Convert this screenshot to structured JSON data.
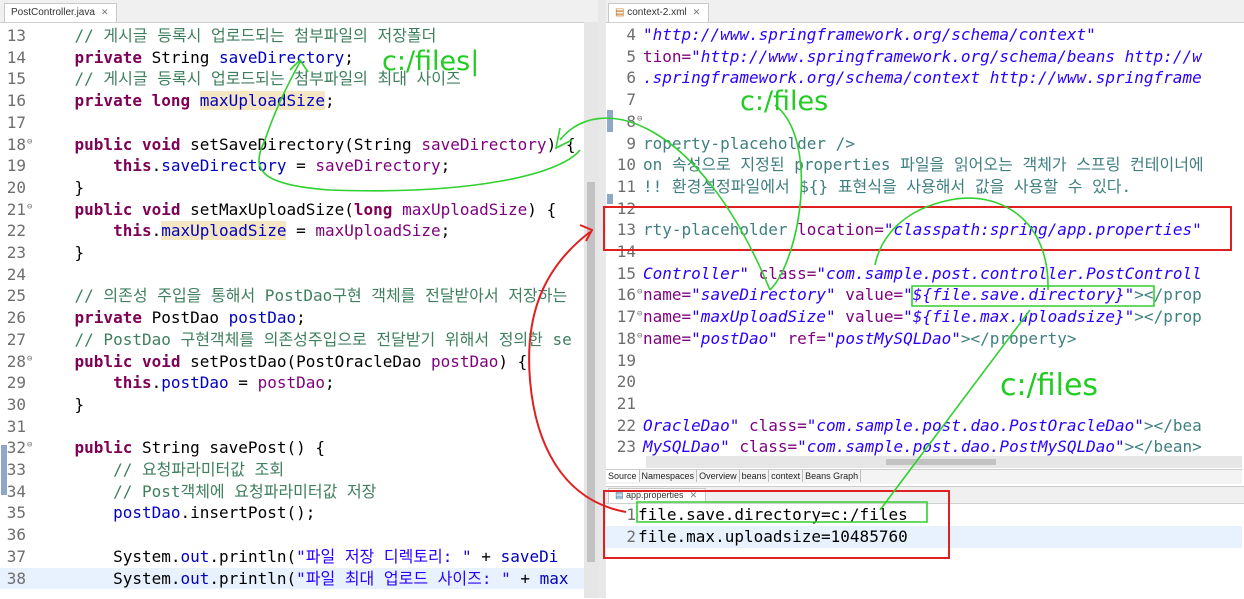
{
  "left_editor": {
    "tab_label": "PostController.java",
    "lines": [
      {
        "n": "13",
        "segs": [
          {
            "t": "    "
          },
          {
            "t": "// 게시글 등록시 업로드되는 첨부파일의 저장폴더",
            "c": "cm"
          }
        ]
      },
      {
        "n": "14",
        "segs": [
          {
            "t": "    "
          },
          {
            "t": "private",
            "c": "kw"
          },
          {
            "t": " String "
          },
          {
            "t": "saveDirectory",
            "c": "fd"
          },
          {
            "t": ";"
          }
        ]
      },
      {
        "n": "15",
        "segs": [
          {
            "t": "    "
          },
          {
            "t": "// 게시글 등록시 업로드되는 첨부파일의 최대 사이즈",
            "c": "cm"
          }
        ]
      },
      {
        "n": "16",
        "segs": [
          {
            "t": "    "
          },
          {
            "t": "private",
            "c": "kw"
          },
          {
            "t": " "
          },
          {
            "t": "long",
            "c": "kw"
          },
          {
            "t": " "
          },
          {
            "t": "maxUploadSize",
            "c": "fd hl"
          },
          {
            "t": ";"
          }
        ]
      },
      {
        "n": "17",
        "segs": [
          {
            "t": ""
          }
        ]
      },
      {
        "n": "18",
        "mark": "⊖",
        "segs": [
          {
            "t": "    "
          },
          {
            "t": "public",
            "c": "kw"
          },
          {
            "t": " "
          },
          {
            "t": "void",
            "c": "kw"
          },
          {
            "t": " setSaveDirectory(String "
          },
          {
            "t": "saveDirectory",
            "c": "at"
          },
          {
            "t": ") {"
          }
        ]
      },
      {
        "n": "19",
        "segs": [
          {
            "t": "        "
          },
          {
            "t": "this",
            "c": "kw"
          },
          {
            "t": "."
          },
          {
            "t": "saveDirectory",
            "c": "fd"
          },
          {
            "t": " = "
          },
          {
            "t": "saveDirectory",
            "c": "at"
          },
          {
            "t": ";"
          }
        ]
      },
      {
        "n": "20",
        "segs": [
          {
            "t": "    }"
          }
        ]
      },
      {
        "n": "21",
        "mark": "⊖",
        "segs": [
          {
            "t": "    "
          },
          {
            "t": "public",
            "c": "kw"
          },
          {
            "t": " "
          },
          {
            "t": "void",
            "c": "kw"
          },
          {
            "t": " setMaxUploadSize("
          },
          {
            "t": "long",
            "c": "kw"
          },
          {
            "t": " "
          },
          {
            "t": "maxUploadSize",
            "c": "at"
          },
          {
            "t": ") {"
          }
        ]
      },
      {
        "n": "22",
        "segs": [
          {
            "t": "        "
          },
          {
            "t": "this",
            "c": "kw"
          },
          {
            "t": "."
          },
          {
            "t": "maxUploadSize",
            "c": "fd hl"
          },
          {
            "t": " = "
          },
          {
            "t": "maxUploadSize",
            "c": "at"
          },
          {
            "t": ";"
          }
        ]
      },
      {
        "n": "23",
        "segs": [
          {
            "t": "    }"
          }
        ]
      },
      {
        "n": "24",
        "segs": [
          {
            "t": ""
          }
        ]
      },
      {
        "n": "25",
        "segs": [
          {
            "t": "    "
          },
          {
            "t": "// 의존성 주입을 통해서 PostDao구현 객체를 전달받아서 저장하는",
            "c": "cm"
          }
        ]
      },
      {
        "n": "26",
        "segs": [
          {
            "t": "    "
          },
          {
            "t": "private",
            "c": "kw"
          },
          {
            "t": " PostDao "
          },
          {
            "t": "postDao",
            "c": "fd"
          },
          {
            "t": ";"
          }
        ]
      },
      {
        "n": "27",
        "segs": [
          {
            "t": "    "
          },
          {
            "t": "// PostDao 구현객체를 의존성주입으로 전달받기 위해서 정의한 se",
            "c": "cm"
          }
        ]
      },
      {
        "n": "28",
        "mark": "⊖",
        "segs": [
          {
            "t": "    "
          },
          {
            "t": "public",
            "c": "kw"
          },
          {
            "t": " "
          },
          {
            "t": "void",
            "c": "kw"
          },
          {
            "t": " setPostDao(PostOracleDao "
          },
          {
            "t": "postDao",
            "c": "at"
          },
          {
            "t": ") {"
          }
        ]
      },
      {
        "n": "29",
        "segs": [
          {
            "t": "        "
          },
          {
            "t": "this",
            "c": "kw"
          },
          {
            "t": "."
          },
          {
            "t": "postDao",
            "c": "fd"
          },
          {
            "t": " = "
          },
          {
            "t": "postDao",
            "c": "at"
          },
          {
            "t": ";"
          }
        ]
      },
      {
        "n": "30",
        "segs": [
          {
            "t": "    }"
          }
        ]
      },
      {
        "n": "31",
        "segs": [
          {
            "t": ""
          }
        ]
      },
      {
        "n": "32",
        "mark": "⊖",
        "segs": [
          {
            "t": "    "
          },
          {
            "t": "public",
            "c": "kw"
          },
          {
            "t": " String savePost() {"
          }
        ]
      },
      {
        "n": "33",
        "segs": [
          {
            "t": "        "
          },
          {
            "t": "// 요청파라미터값 조회",
            "c": "cm"
          }
        ]
      },
      {
        "n": "34",
        "segs": [
          {
            "t": "        "
          },
          {
            "t": "// Post객체에 요청파라미터값 저장",
            "c": "cm"
          }
        ]
      },
      {
        "n": "35",
        "segs": [
          {
            "t": "        "
          },
          {
            "t": "postDao",
            "c": "fd"
          },
          {
            "t": ".insertPost();"
          }
        ]
      },
      {
        "n": "36",
        "segs": [
          {
            "t": ""
          }
        ]
      },
      {
        "n": "37",
        "segs": [
          {
            "t": "        System."
          },
          {
            "t": "out",
            "c": "fd"
          },
          {
            "t": ".println("
          },
          {
            "t": "\"파일 저장 디렉토리: \"",
            "c": "st"
          },
          {
            "t": " + "
          },
          {
            "t": "saveDi",
            "c": "fd"
          }
        ]
      },
      {
        "n": "38",
        "segs": [
          {
            "t": "        System."
          },
          {
            "t": "out",
            "c": "fd"
          },
          {
            "t": ".println("
          },
          {
            "t": "\"파일 최대 업로드 사이즈: \"",
            "c": "st"
          },
          {
            "t": " + "
          },
          {
            "t": "max",
            "c": "fd"
          }
        ]
      }
    ]
  },
  "xml_editor": {
    "tab_label": "context-2.xml",
    "lines": [
      {
        "n": "4",
        "segs": [
          {
            "t": "\"http://www.springframework.org/schema/context\"",
            "c": "av"
          }
        ]
      },
      {
        "n": "5",
        "segs": [
          {
            "t": "tion=",
            "c": "at"
          },
          {
            "t": "\"http://www.springframework.org/schema/beans http://w",
            "c": "av"
          }
        ]
      },
      {
        "n": "6",
        "segs": [
          {
            "t": ".springframework.org/schema/context http://www.springframe",
            "c": "av"
          }
        ]
      },
      {
        "n": "7",
        "segs": [
          {
            "t": ""
          }
        ]
      },
      {
        "n": "8",
        "mark": "⊖",
        "segs": [
          {
            "t": ""
          }
        ]
      },
      {
        "n": "9",
        "segs": [
          {
            "t": "roperty-placeholder />",
            "c": "el"
          }
        ]
      },
      {
        "n": "10",
        "segs": [
          {
            "t": "on 속성으로 지정된 properties 파일을 읽어오는 객체가 스프링 컨테이너에 ",
            "c": "el"
          }
        ]
      },
      {
        "n": "11",
        "segs": [
          {
            "t": "!! 환경설정파일에서 ${} 표현식을 사용해서 값을 사용할 수 있다.",
            "c": "el"
          }
        ]
      },
      {
        "n": "12",
        "segs": [
          {
            "t": ""
          }
        ]
      },
      {
        "n": "13",
        "segs": [
          {
            "t": "rty-placeholder ",
            "c": "el"
          },
          {
            "t": "location=",
            "c": "at"
          },
          {
            "t": "\"classpath:spring/app.properties\"",
            "c": "av"
          }
        ]
      },
      {
        "n": "14",
        "segs": [
          {
            "t": ""
          }
        ]
      },
      {
        "n": "15",
        "segs": [
          {
            "t": "Controller\"",
            "c": "av"
          },
          {
            "t": " class=",
            "c": "at"
          },
          {
            "t": "\"com.sample.post.controller.PostControll",
            "c": "av"
          }
        ]
      },
      {
        "n": "16",
        "mark": "⊖",
        "segs": [
          {
            "t": "name=",
            "c": "at"
          },
          {
            "t": "\"saveDirectory\"",
            "c": "av"
          },
          {
            "t": " value=",
            "c": "at"
          },
          {
            "t": "\"${file.save.directory}\"",
            "c": "av"
          },
          {
            "t": "></prop",
            "c": "el"
          }
        ]
      },
      {
        "n": "17",
        "mark": "⊖",
        "segs": [
          {
            "t": "name=",
            "c": "at"
          },
          {
            "t": "\"maxUploadSize\"",
            "c": "av"
          },
          {
            "t": " value=",
            "c": "at"
          },
          {
            "t": "\"${file.max.uploadsize}\"",
            "c": "av"
          },
          {
            "t": "></prop",
            "c": "el"
          }
        ]
      },
      {
        "n": "18",
        "mark": "⊖",
        "segs": [
          {
            "t": "name=",
            "c": "at"
          },
          {
            "t": "\"postDao\"",
            "c": "av"
          },
          {
            "t": " ref=",
            "c": "at"
          },
          {
            "t": "\"postMySQLDao\"",
            "c": "av"
          },
          {
            "t": "></property>",
            "c": "el"
          }
        ]
      },
      {
        "n": "19",
        "segs": [
          {
            "t": ""
          }
        ]
      },
      {
        "n": "20",
        "segs": [
          {
            "t": ""
          }
        ]
      },
      {
        "n": "21",
        "segs": [
          {
            "t": ""
          }
        ]
      },
      {
        "n": "22",
        "segs": [
          {
            "t": "OracleDao\"",
            "c": "av"
          },
          {
            "t": " class=",
            "c": "at"
          },
          {
            "t": "\"com.sample.post.dao.PostOracleDao\"",
            "c": "av"
          },
          {
            "t": "></bea",
            "c": "el"
          }
        ]
      },
      {
        "n": "23",
        "segs": [
          {
            "t": "MySQLDao\"",
            "c": "av"
          },
          {
            "t": " class=",
            "c": "at"
          },
          {
            "t": "\"com.sample.post.dao.PostMySQLDao\"",
            "c": "av"
          },
          {
            "t": "></bean>",
            "c": "el"
          }
        ]
      }
    ],
    "bottom_tabs": [
      "Source",
      "Namespaces",
      "Overview",
      "beans",
      "context",
      "Beans Graph"
    ]
  },
  "props_editor": {
    "tab_label": "app.properties",
    "lines": [
      {
        "n": "1",
        "segs": [
          {
            "t": "file.save.directory=c:/files"
          }
        ]
      },
      {
        "n": "2",
        "segs": [
          {
            "t": "file.max.uploadsize=10485760"
          }
        ]
      }
    ]
  },
  "annotations": {
    "label_1": "c:/files|",
    "label_2": "c:/files",
    "label_3": "c:/files",
    "color": "#22cc22",
    "box_color": "#e02020"
  }
}
